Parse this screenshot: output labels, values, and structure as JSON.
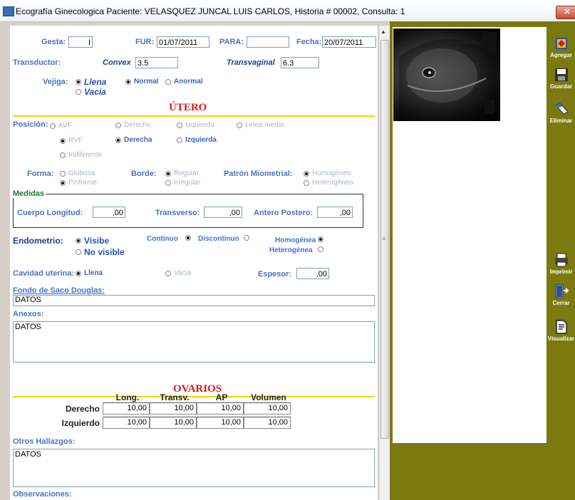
{
  "window": {
    "title": "Ecografía Ginecologica  Paciente: VELASQUEZ JUNCAL LUIS CARLOS, Historia # 00002, Consulta: 1",
    "close_label": "✕"
  },
  "header": {
    "gesta_label": "Gesta:",
    "gesta_value": "I",
    "fur_label": "FUR:",
    "fur_value": "01/07/2011",
    "para_label": "PARA:",
    "para_value": "",
    "fecha_label": "Fecha:",
    "fecha_value": "20/07/2011",
    "transductor_label": "Transductor:",
    "convex_label": "Convex",
    "convex_value": "3.5",
    "transvaginal_label": "Transvaginal",
    "transvaginal_value": "6.3",
    "vejiga_label": "Vejiga:",
    "vejiga_options": [
      "Llena",
      "Vacia"
    ],
    "vejiga_options2": [
      "Normal",
      "Anormal"
    ]
  },
  "utero": {
    "title": "ÚTERO",
    "posicion_label": "Posición:",
    "posicion_row1": [
      "AVF",
      "Derecho",
      "Izquierdo",
      "Linea media"
    ],
    "posicion_row2": [
      "RVF",
      "Derecha",
      "Izquierda"
    ],
    "posicion_row3": [
      "Indiferente"
    ],
    "forma_label": "Forma:",
    "forma_options": [
      "Globosa",
      "Piriforme"
    ],
    "borde_label": "Borde:",
    "borde_options": [
      "Regular",
      "Irregular"
    ],
    "patron_label": "Patrón Miometrial:",
    "patron_options": [
      "Homogéneo",
      "Heterogéneo"
    ],
    "medidas_label": "Medidas",
    "cuerpo_label": "Cuerpo Longitud:",
    "cuerpo_value": ",00",
    "transverso_label": "Transverso:",
    "transverso_value": ",00",
    "antero_label": "Antero Postero:",
    "antero_value": ",00",
    "endometrio_label": "Endometrio:",
    "endometrio_options": [
      "Visibe",
      "No visible"
    ],
    "continuo_label": "Continuo",
    "discontinuo_label": "Discontinuo",
    "homogenea_label": "Homogénea",
    "heterogenea_label": "Heterogénea",
    "cavidad_label": "Cavidad uterina:",
    "cavidad_options": [
      "Llena",
      "Vacia"
    ],
    "espesor_label": "Espesor:",
    "espesor_value": ",00",
    "fondo_label": "Fondo de Saco Douglas:",
    "fondo_value": "DATOS",
    "anexos_label": "Anexos:",
    "anexos_value": "DATOS"
  },
  "ovarios": {
    "title": "OVARIOS",
    "columns": [
      "Long.",
      "Transv.",
      "AP",
      "Volumen"
    ],
    "rows": [
      {
        "label": "Derecho",
        "values": [
          "10,00",
          "10,00",
          "10,00",
          "10,00"
        ]
      },
      {
        "label": "Izquierdo",
        "values": [
          "10,00",
          "10,00",
          "10,00",
          "10,00"
        ]
      }
    ],
    "otros_label": "Otros Hallazgos:",
    "otros_value": "DATOS",
    "observaciones_label": "Observaciones:"
  },
  "toolbar": {
    "buttons": [
      "Agregar",
      "Guardar",
      "Eliminar",
      "Imprimir",
      "Cerrar",
      "Visualizar"
    ]
  },
  "colors": {
    "label_blue": "#4a72c4",
    "section_red": "#e0141a",
    "divider_yellow": "#f2d500",
    "panel_olive": "#7a7a10"
  }
}
